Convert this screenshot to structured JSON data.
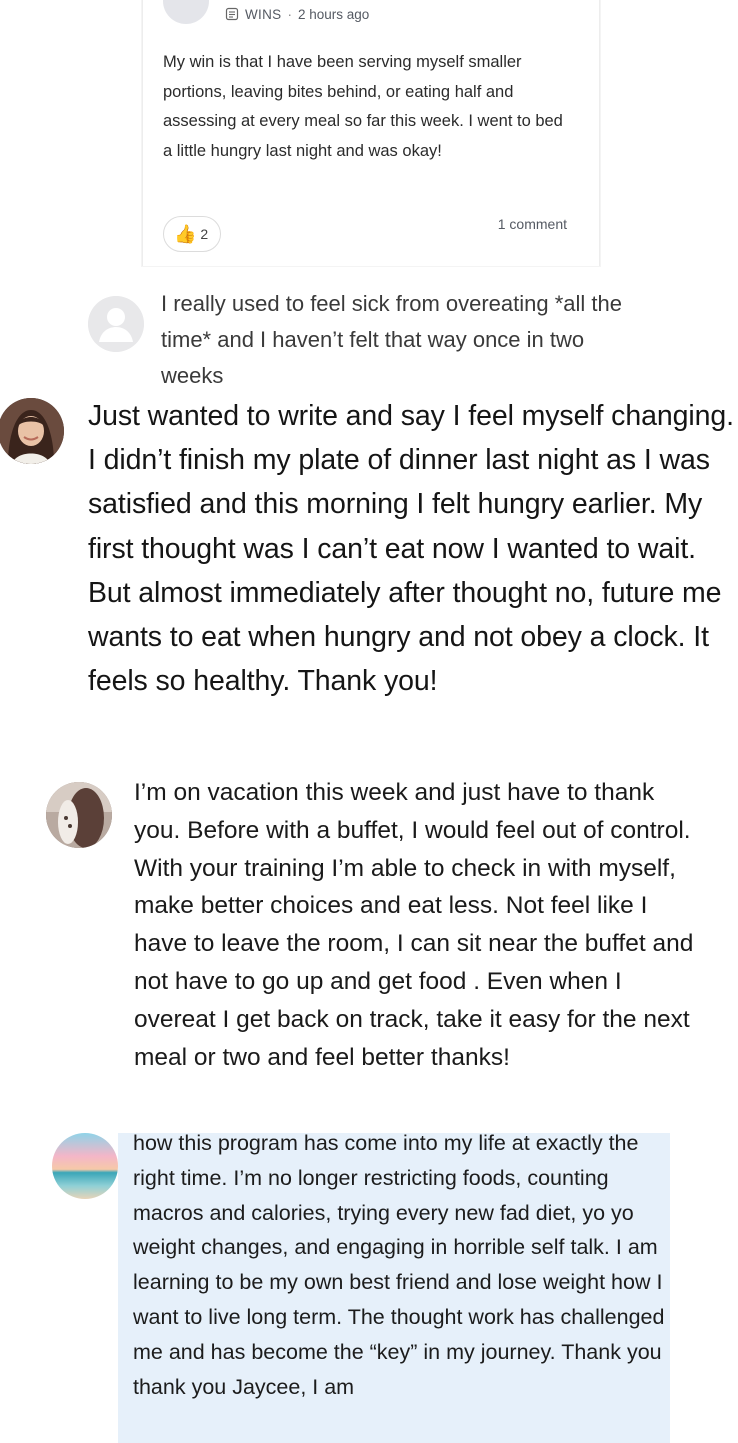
{
  "post": {
    "category": "WINS",
    "separator": "·",
    "time": "2 hours ago",
    "body": "My win is that I have been serving myself smaller portions, leaving bites behind, or eating half and assessing at every meal so far this week. I went to bed a little hungry last night and was okay!",
    "like_emoji": "👍",
    "like_count": "2",
    "comments_label": "1 comment"
  },
  "comments": [
    {
      "avatar": "default-user-icon",
      "text": "I really used to feel sick from overeating *all the time* and I haven’t felt that way once in two weeks"
    },
    {
      "avatar": "woman-photo",
      "text": "Just wanted to write and say I feel myself changing. I didn’t finish my plate of dinner last night as I was satisfied and this morning I felt hungry earlier. My first thought was I can’t eat now I wanted to wait. But almost immediately after thought no, future me wants to eat when hungry and not obey a clock. It feels so healthy. Thank you!"
    },
    {
      "avatar": "photo",
      "text": "I’m on vacation this week and just have to thank you. Before with a buffet, I would feel out of control. With your training I’m able to check in with myself, make better choices and eat less. Not feel like I have to leave the room, I can sit near the buffet and not have to go up and get food . Even when I overeat I get back on track, take it easy for the next meal or two and feel better thanks!"
    },
    {
      "avatar": "beach-sunset-photo",
      "highlight_color": "#e6f0fa",
      "text": "how this program has come into my life at exactly the right time.  I’m no longer restricting foods, counting macros and calories, trying every new fad diet, yo yo weight changes, and engaging in horrible self talk.  I am learning to be my own best friend and lose weight how I want to live long term.  The thought work has challenged me and has become the “key” in my journey.  Thank you thank you Jaycee, I am"
    }
  ]
}
